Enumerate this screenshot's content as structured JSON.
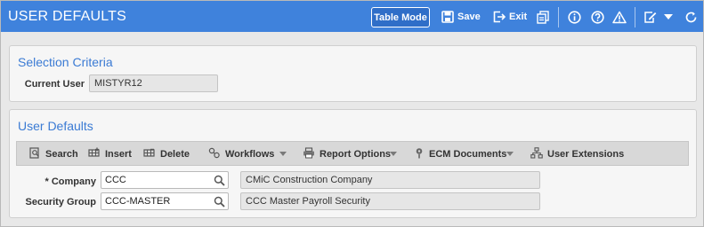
{
  "header": {
    "title": "USER DEFAULTS",
    "table_mode_label": "Table Mode",
    "save_label": "Save",
    "exit_label": "Exit",
    "background_color": "#3f82dc",
    "icons": [
      "save-icon",
      "exit-icon",
      "copy-icon",
      "info-icon",
      "help-icon",
      "warning-icon",
      "edit-note-icon",
      "dropdown-caret-icon",
      "refresh-icon"
    ]
  },
  "selection_criteria": {
    "title": "Selection Criteria",
    "current_user_label": "Current User",
    "current_user_value": "MISTYR12"
  },
  "user_defaults": {
    "title": "User Defaults",
    "toolbar": {
      "search_label": "Search",
      "insert_label": "Insert",
      "delete_label": "Delete",
      "workflows_label": "Workflows",
      "report_options_label": "Report Options",
      "ecm_documents_label": "ECM Documents",
      "user_extensions_label": "User Extensions"
    },
    "company": {
      "label": "* Company",
      "value": "CCC",
      "description": "CMiC Construction Company"
    },
    "security_group": {
      "label": "Security Group",
      "value": "CCC-MASTER",
      "description": "CCC Master Payroll Security"
    }
  },
  "accent_color": "#3b7bd4"
}
